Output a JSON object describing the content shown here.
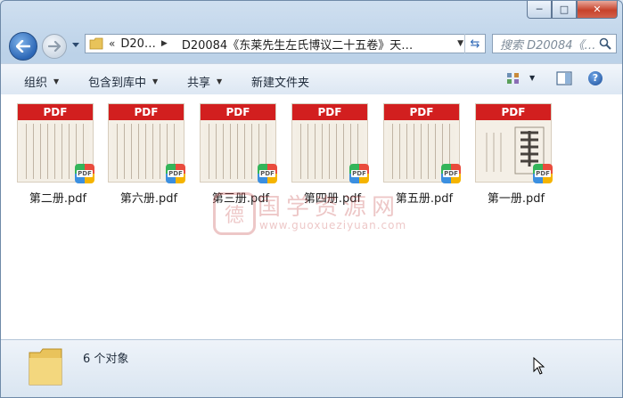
{
  "window": {
    "minimize_label": "─",
    "maximize_label": "□",
    "close_label": "✕"
  },
  "nav": {
    "chevron_label": "«",
    "path_segment_1": "D20…",
    "path_segment_2": "D20084《东莱先生左氏博议二十五卷》天…",
    "search_placeholder": "搜索 D20084《…"
  },
  "toolbar": {
    "organize_label": "组织",
    "include_library_label": "包含到库中",
    "share_label": "共享",
    "new_folder_label": "新建文件夹",
    "help_label": "?"
  },
  "files": [
    {
      "name": "第二册.pdf",
      "band": "PDF",
      "badge": "PDF"
    },
    {
      "name": "第六册.pdf",
      "band": "PDF",
      "badge": "PDF"
    },
    {
      "name": "第三册.pdf",
      "band": "PDF",
      "badge": "PDF"
    },
    {
      "name": "第四册.pdf",
      "band": "PDF",
      "badge": "PDF"
    },
    {
      "name": "第五册.pdf",
      "band": "PDF",
      "badge": "PDF"
    },
    {
      "name": "第一册.pdf",
      "band": "PDF",
      "badge": "PDF"
    }
  ],
  "watermark": {
    "seal_char": "德",
    "title": "国学资源网",
    "url": "www.guoxueziyuan.com"
  },
  "status": {
    "count_label": "6 个对象"
  },
  "colors": {
    "pdf_band": "#d21f1f",
    "accent_blue": "#2c67b6",
    "close_red": "#c7422b"
  }
}
